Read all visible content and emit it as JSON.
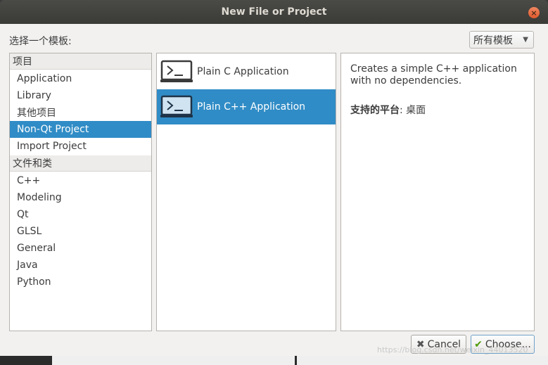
{
  "window": {
    "title": "New File or Project"
  },
  "header": {
    "choose_label": "选择一个模板:",
    "filter_value": "所有模板"
  },
  "categories": {
    "groups": [
      {
        "title": "项目",
        "items": [
          "Application",
          "Library",
          "其他项目",
          "Non-Qt Project",
          "Import Project"
        ]
      },
      {
        "title": "文件和类",
        "items": [
          "C++",
          "Modeling",
          "Qt",
          "GLSL",
          "General",
          "Java",
          "Python"
        ]
      }
    ],
    "selected": "Non-Qt Project"
  },
  "templates": {
    "items": [
      "Plain C Application",
      "Plain C++ Application"
    ],
    "selected": "Plain C++ Application"
  },
  "description": {
    "text": "Creates a simple C++ application with no dependencies.",
    "platform_label": "支持的平台",
    "platform_value": ": 桌面"
  },
  "buttons": {
    "cancel": "Cancel",
    "choose": "Choose..."
  },
  "watermark": "https://blog.csdn.net/weixin_44013520"
}
